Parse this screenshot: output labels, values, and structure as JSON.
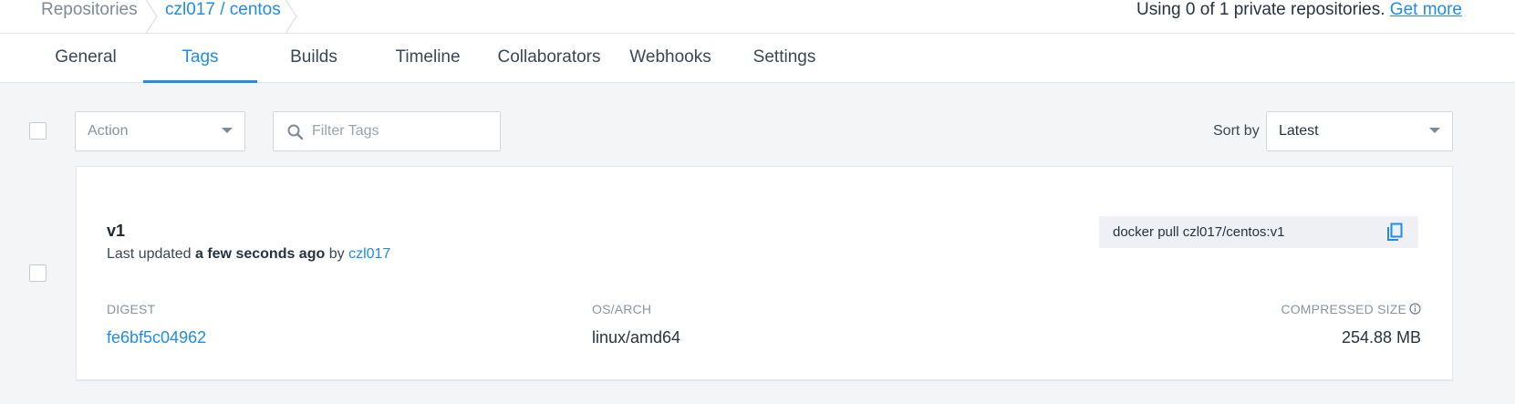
{
  "breadcrumb": {
    "items": [
      "Repositories",
      "czl017 / centos"
    ]
  },
  "usage": {
    "text": "Using 0 of 1 private repositories.",
    "link": "Get more"
  },
  "tabs": [
    {
      "label": "General"
    },
    {
      "label": "Tags"
    },
    {
      "label": "Builds"
    },
    {
      "label": "Timeline"
    },
    {
      "label": "Collaborators"
    },
    {
      "label": "Webhooks"
    },
    {
      "label": "Settings"
    }
  ],
  "active_tab": "Tags",
  "toolbar": {
    "action_label": "Action",
    "filter_placeholder": "Filter Tags",
    "sort_label": "Sort by",
    "sort_value": "Latest"
  },
  "tag": {
    "name": "v1",
    "updated_prefix": "Last updated",
    "updated_when": "a few seconds ago",
    "updated_by_prefix": "by",
    "updated_by": "czl017",
    "pull_command": "docker pull czl017/centos:v1",
    "digest_header": "DIGEST",
    "digest": "fe6bf5c04962",
    "osarch_header": "OS/ARCH",
    "osarch": "linux/amd64",
    "size_header": "COMPRESSED SIZE",
    "size": "254.88 MB"
  },
  "colors": {
    "accent": "#1f8ceb",
    "text": "#27343f",
    "muted": "#8a949e",
    "background": "#f4f5f7"
  },
  "icons": [
    "search-icon",
    "copy-icon",
    "info-icon",
    "chevron-down-icon"
  ]
}
